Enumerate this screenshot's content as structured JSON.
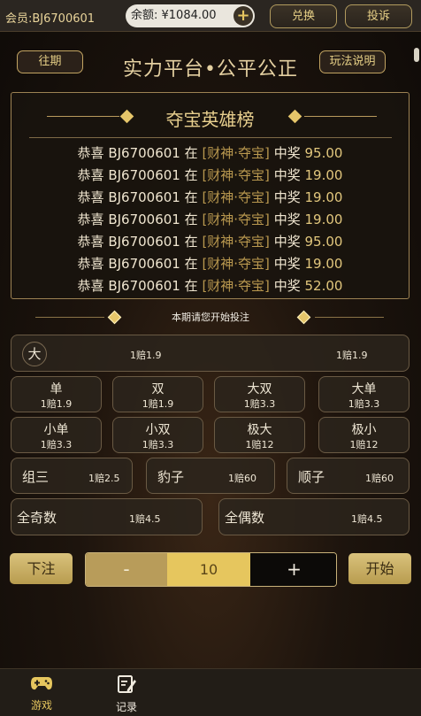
{
  "topbar": {
    "member": "会员:BJ6700601",
    "balance": "余额: ¥1084.00",
    "plus": "+",
    "exchange_label": "兑换",
    "complaint_label": "投诉"
  },
  "header": {
    "history_label": "往期",
    "title": "实力平台•公平公正",
    "rules_label": "玩法说明"
  },
  "winners": {
    "title": "夺宝英雄榜",
    "rows": [
      {
        "prefix": "恭喜",
        "account": "BJ6700601",
        "mid": "在",
        "game": "[财神·夺宝]",
        "win": "中奖",
        "amount": "95.00"
      },
      {
        "prefix": "恭喜",
        "account": "BJ6700601",
        "mid": "在",
        "game": "[财神·夺宝]",
        "win": "中奖",
        "amount": "19.00"
      },
      {
        "prefix": "恭喜",
        "account": "BJ6700601",
        "mid": "在",
        "game": "[财神·夺宝]",
        "win": "中奖",
        "amount": "19.00"
      },
      {
        "prefix": "恭喜",
        "account": "BJ6700601",
        "mid": "在",
        "game": "[财神·夺宝]",
        "win": "中奖",
        "amount": "19.00"
      },
      {
        "prefix": "恭喜",
        "account": "BJ6700601",
        "mid": "在",
        "game": "[财神·夺宝]",
        "win": "中奖",
        "amount": "95.00"
      },
      {
        "prefix": "恭喜",
        "account": "BJ6700601",
        "mid": "在",
        "game": "[财神·夺宝]",
        "win": "中奖",
        "amount": "19.00"
      },
      {
        "prefix": "恭喜",
        "account": "BJ6700601",
        "mid": "在",
        "game": "[财神·夺宝]",
        "win": "中奖",
        "amount": "52.00"
      }
    ]
  },
  "status": {
    "message": "本期请您开始投注"
  },
  "bets": {
    "big": {
      "name": "大",
      "odds": "1赔1.9"
    },
    "small_odds": "1赔1.9",
    "row2": [
      {
        "name": "单",
        "odds": "1赔1.9"
      },
      {
        "name": "双",
        "odds": "1赔1.9"
      },
      {
        "name": "大双",
        "odds": "1赔3.3"
      },
      {
        "name": "大单",
        "odds": "1赔3.3"
      }
    ],
    "row3": [
      {
        "name": "小单",
        "odds": "1赔3.3"
      },
      {
        "name": "小双",
        "odds": "1赔3.3"
      },
      {
        "name": "极大",
        "odds": "1赔12"
      },
      {
        "name": "极小",
        "odds": "1赔12"
      }
    ],
    "row4": [
      {
        "name": "组三",
        "odds": "1赔2.5"
      },
      {
        "name": "豹子",
        "odds": "1赔60"
      },
      {
        "name": "顺子",
        "odds": "1赔60"
      }
    ],
    "row5": [
      {
        "name": "全奇数",
        "odds": "1赔4.5"
      },
      {
        "name": "全偶数",
        "odds": "1赔4.5"
      }
    ]
  },
  "betting": {
    "place_label": "下注",
    "minus": "-",
    "amount": "10",
    "plus": "+",
    "start_label": "开始"
  },
  "nav": {
    "game_label": "游戏",
    "record_label": "记录"
  },
  "colors": {
    "accent_gold": "#e6c65e",
    "panel_border": "#9c8253",
    "background": "#1d140d"
  }
}
